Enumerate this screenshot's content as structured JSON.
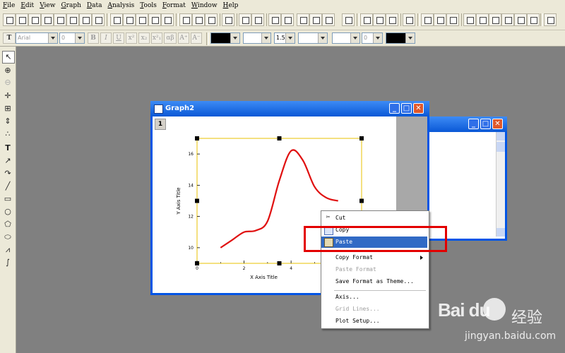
{
  "menubar": {
    "items": [
      "File",
      "Edit",
      "View",
      "Graph",
      "Data",
      "Analysis",
      "Tools",
      "Format",
      "Window",
      "Help"
    ]
  },
  "format_toolbar": {
    "font_name": "Arial",
    "font_size": "0",
    "bold": "B",
    "italic": "I",
    "underline": "U",
    "superscript": "x²",
    "subscript": "x₂",
    "super_sub": "x²₁",
    "greek": "αβ",
    "increase_font": "A⁺",
    "decrease_font": "A⁻",
    "line_width": "1.5",
    "pattern_width": "0"
  },
  "graph_window": {
    "title": "Graph2",
    "layer_label": "1"
  },
  "plot": {
    "ytick_labels": [
      "10",
      "12",
      "14",
      "16"
    ],
    "xtick_labels": [
      "0",
      "2",
      "4"
    ]
  },
  "chart_data": {
    "type": "line",
    "xlabel": "X Axis Title",
    "ylabel": "Y Axis Title",
    "xlim": [
      0,
      7
    ],
    "ylim": [
      9,
      17
    ],
    "x": [
      1.0,
      1.5,
      2.0,
      2.5,
      3.0,
      3.5,
      4.0,
      4.5,
      5.0,
      5.5,
      6.0
    ],
    "series": [
      {
        "values": [
          10.0,
          10.5,
          11.0,
          11.1,
          11.7,
          14.3,
          16.2,
          15.6,
          13.9,
          13.2,
          13.0
        ],
        "color": "#e01010"
      }
    ],
    "grid": false
  },
  "context_menu": {
    "items": [
      {
        "label": "Cut",
        "icon": "scissors-icon",
        "enabled": true
      },
      {
        "label": "Copy",
        "icon": "copy-icon",
        "enabled": true
      },
      {
        "label": "Paste",
        "icon": "paste-icon",
        "enabled": true,
        "highlighted": true
      },
      {
        "label": "Copy Format",
        "enabled": true,
        "submenu": true
      },
      {
        "label": "Paste Format",
        "enabled": false
      },
      {
        "label": "Save Format as Theme...",
        "enabled": true
      },
      {
        "label": "Axis...",
        "enabled": true
      },
      {
        "label": "Grid Lines...",
        "enabled": false
      },
      {
        "label": "Plot Setup...",
        "enabled": true
      }
    ]
  },
  "colors": {
    "titlebar": "#0a58d6",
    "highlight": "#316ac5",
    "annotation": "#e30000",
    "curve": "#e01010",
    "frame": "#e8c000"
  },
  "watermark": {
    "brand": "Bai du",
    "cn_text": "经验",
    "url": "jingyan.baidu.com"
  }
}
